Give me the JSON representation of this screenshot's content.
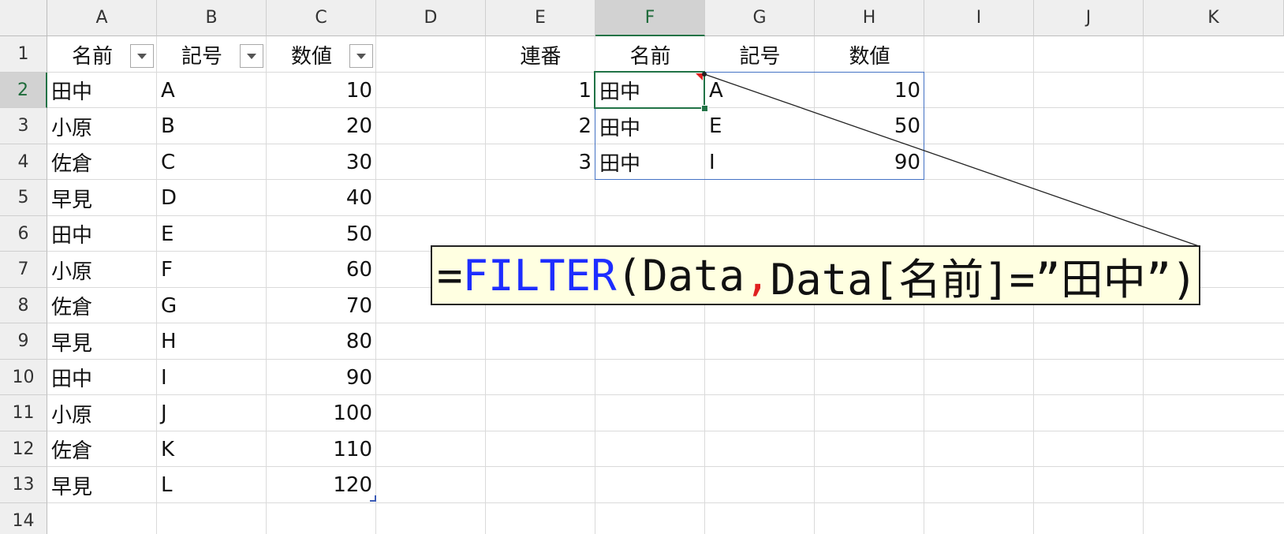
{
  "columns": [
    "A",
    "B",
    "C",
    "D",
    "E",
    "F",
    "G",
    "H",
    "I",
    "J",
    "K"
  ],
  "rows": [
    "1",
    "2",
    "3",
    "4",
    "5",
    "6",
    "7",
    "8",
    "9",
    "10",
    "11",
    "12",
    "13",
    "14"
  ],
  "active_cell": "F2",
  "source_table": {
    "headers": [
      "名前",
      "記号",
      "数値"
    ],
    "rows": [
      [
        "田中",
        "A",
        "10"
      ],
      [
        "小原",
        "B",
        "20"
      ],
      [
        "佐倉",
        "C",
        "30"
      ],
      [
        "早見",
        "D",
        "40"
      ],
      [
        "田中",
        "E",
        "50"
      ],
      [
        "小原",
        "F",
        "60"
      ],
      [
        "佐倉",
        "G",
        "70"
      ],
      [
        "早見",
        "H",
        "80"
      ],
      [
        "田中",
        "I",
        "90"
      ],
      [
        "小原",
        "J",
        "100"
      ],
      [
        "佐倉",
        "K",
        "110"
      ],
      [
        "早見",
        "L",
        "120"
      ]
    ]
  },
  "result_table": {
    "headers": [
      "連番",
      "名前",
      "記号",
      "数値"
    ],
    "rows": [
      [
        "1",
        "田中",
        "A",
        "10"
      ],
      [
        "2",
        "田中",
        "E",
        "50"
      ],
      [
        "3",
        "田中",
        "I",
        "90"
      ]
    ]
  },
  "formula": {
    "eq": "=",
    "func": "FILTER",
    "open": "(Data",
    "comma": ",",
    "rest": "Data[名前]=”田中”)"
  },
  "icons": {
    "filter_dropdown": "chevron-down-icon",
    "error_indicator": "comment-indicator-icon",
    "fill_handle": "fill-handle-icon"
  },
  "colors": {
    "selection_green": "#217346",
    "spill_border_blue": "#4472c4",
    "formula_function_blue": "#1d2dff",
    "formula_comma_red": "#e02020",
    "callout_bg": "#ffffe1",
    "indicator_red": "#e02020"
  }
}
